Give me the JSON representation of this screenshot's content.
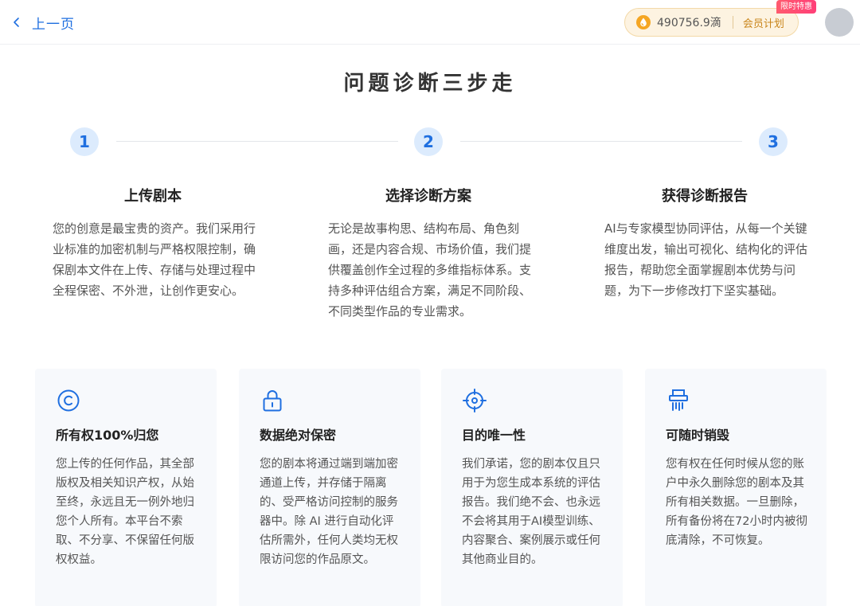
{
  "header": {
    "back_label": "上一页",
    "points_value": "490756.9滴",
    "member_label": "会员计划",
    "badge_label": "限时特惠",
    "colors": {
      "accent": "#1f6fe0",
      "gold": "#c9861c",
      "badge": "#ff4a74"
    }
  },
  "title": "问题诊断三步走",
  "steps": [
    {
      "number": "1",
      "title": "上传剧本",
      "desc": "您的创意是最宝贵的资产。我们采用行业标准的加密机制与严格权限控制，确保剧本文件在上传、存储与处理过程中全程保密、不外泄，让创作更安心。"
    },
    {
      "number": "2",
      "title": "选择诊断方案",
      "desc": "无论是故事构思、结构布局、角色刻画，还是内容合规、市场价值，我们提供覆盖创作全过程的多维指标体系。支持多种评估组合方案，满足不同阶段、不同类型作品的专业需求。"
    },
    {
      "number": "3",
      "title": "获得诊断报告",
      "desc": "AI与专家模型协同评估，从每一个关键维度出发，输出可视化、结构化的评估报告，帮助您全面掌握剧本优势与问题，为下一步修改打下坚实基础。"
    }
  ],
  "cards": [
    {
      "icon": "copyright-icon",
      "title": "所有权100%归您",
      "desc": "您上传的任何作品，其全部版权及相关知识产权，从始至终，永远且无一例外地归您个人所有。本平台不索取、不分享、不保留任何版权权益。"
    },
    {
      "icon": "lock-icon",
      "title": "数据绝对保密",
      "desc": "您的剧本将通过端到端加密通道上传，并存储于隔离的、受严格访问控制的服务器中。除 AI 进行自动化评估所需外，任何人类均无权限访问您的作品原文。"
    },
    {
      "icon": "target-icon",
      "title": "目的唯一性",
      "desc": "我们承诺，您的剧本仅且只用于为您生成本系统的评估报告。我们绝不会、也永远不会将其用于AI模型训练、内容聚合、案例展示或任何其他商业目的。"
    },
    {
      "icon": "shredder-icon",
      "title": "可随时销毁",
      "desc": "您有权在任何时候从您的账户中永久删除您的剧本及其所有相关数据。一旦删除，所有备份将在72小时内被彻底清除，不可恢复。"
    }
  ]
}
